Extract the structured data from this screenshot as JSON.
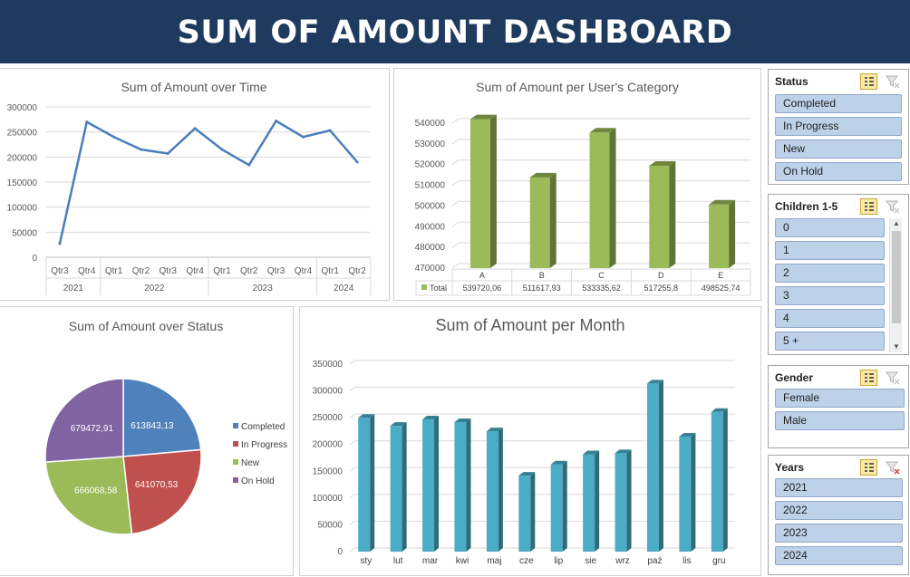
{
  "header": {
    "title": "SUM OF AMOUNT DASHBOARD"
  },
  "colors": {
    "header_bg": "#1e3a5f",
    "line": "#4a7ebb",
    "bar3d_green": "#9bbb59",
    "bar3d_blue": "#4bacc6",
    "pie": [
      "#4f81bd",
      "#c0504d",
      "#9bbb59",
      "#8064a2"
    ],
    "slicer_item": "#bdd1e8"
  },
  "time_chart": {
    "title": "Sum of Amount over Time",
    "yticks": [
      "300000",
      "250000",
      "200000",
      "150000",
      "100000",
      "50000",
      "0"
    ],
    "quarters": [
      "Qtr3",
      "Qtr4",
      "Qtr1",
      "Qtr2",
      "Qtr3",
      "Qtr4",
      "Qtr1",
      "Qtr2",
      "Qtr3",
      "Qtr4",
      "Qtr1",
      "Qtr2"
    ],
    "years": [
      {
        "label": "2021",
        "span": 2
      },
      {
        "label": "2022",
        "span": 4
      },
      {
        "label": "2023",
        "span": 4
      },
      {
        "label": "2024",
        "span": 2
      }
    ]
  },
  "category_chart": {
    "title": "Sum of Amount per User's Category",
    "yticks": [
      "540000",
      "530000",
      "520000",
      "510000",
      "500000",
      "490000",
      "480000",
      "470000"
    ],
    "legend": "Total",
    "categories": [
      "A",
      "B",
      "C",
      "D",
      "E"
    ],
    "value_labels": [
      "539720,06",
      "511617,93",
      "533335,62",
      "517255,8",
      "498525,74"
    ]
  },
  "status_chart": {
    "title": "Sum of Amount over Status",
    "labels": [
      "Completed",
      "In Progress",
      "New",
      "On Hold"
    ],
    "value_labels": [
      "613843,13",
      "641070,53",
      "666068,58",
      "679472,91"
    ]
  },
  "month_chart": {
    "title": "Sum of Amount per Month",
    "yticks": [
      "350000",
      "300000",
      "250000",
      "200000",
      "150000",
      "100000",
      "50000",
      "0"
    ],
    "months": [
      "sty",
      "lut",
      "mar",
      "kwi",
      "maj",
      "cze",
      "lip",
      "sie",
      "wrz",
      "paź",
      "lis",
      "gru"
    ]
  },
  "chart_data": [
    {
      "type": "line",
      "title": "Sum of Amount over Time",
      "x": [
        "2021 Qtr3",
        "2021 Qtr4",
        "2022 Qtr1",
        "2022 Qtr2",
        "2022 Qtr3",
        "2022 Qtr4",
        "2023 Qtr1",
        "2023 Qtr2",
        "2023 Qtr3",
        "2023 Qtr4",
        "2024 Qtr1",
        "2024 Qtr2"
      ],
      "values": [
        27000,
        270000,
        240000,
        215000,
        207000,
        257000,
        215000,
        184000,
        272000,
        240000,
        253000,
        190000
      ],
      "ylim": [
        0,
        300000
      ],
      "grid": true
    },
    {
      "type": "bar",
      "title": "Sum of Amount per User's Category",
      "categories": [
        "A",
        "B",
        "C",
        "D",
        "E"
      ],
      "values": [
        539720.06,
        511617.93,
        533335.62,
        517255.8,
        498525.74
      ],
      "series": [
        {
          "name": "Total",
          "values": [
            539720.06,
            511617.93,
            533335.62,
            517255.8,
            498525.74
          ]
        }
      ],
      "ylim": [
        470000,
        540000
      ],
      "grid": true
    },
    {
      "type": "pie",
      "title": "Sum of Amount over Status",
      "categories": [
        "Completed",
        "In Progress",
        "New",
        "On Hold"
      ],
      "values": [
        613843.13,
        641070.53,
        666068.58,
        679472.91
      ],
      "legend": "right"
    },
    {
      "type": "bar",
      "title": "Sum of Amount per Month",
      "categories": [
        "sty",
        "lut",
        "mar",
        "kwi",
        "maj",
        "cze",
        "lip",
        "sie",
        "wrz",
        "paź",
        "lis",
        "gru"
      ],
      "values": [
        243000,
        228000,
        240000,
        235000,
        218000,
        135000,
        156000,
        175000,
        177000,
        307000,
        208000,
        254000
      ],
      "ylim": [
        0,
        350000
      ],
      "grid": true
    }
  ],
  "slicers": {
    "status": {
      "title": "Status",
      "items": [
        "Completed",
        "In Progress",
        "New",
        "On Hold"
      ]
    },
    "children": {
      "title": "Children 1-5",
      "items": [
        "0",
        "1",
        "2",
        "3",
        "4",
        "5 +"
      ]
    },
    "gender": {
      "title": "Gender",
      "items": [
        "Female",
        "Male"
      ]
    },
    "years": {
      "title": "Years",
      "items": [
        "2021",
        "2022",
        "2023",
        "2024"
      ]
    }
  }
}
